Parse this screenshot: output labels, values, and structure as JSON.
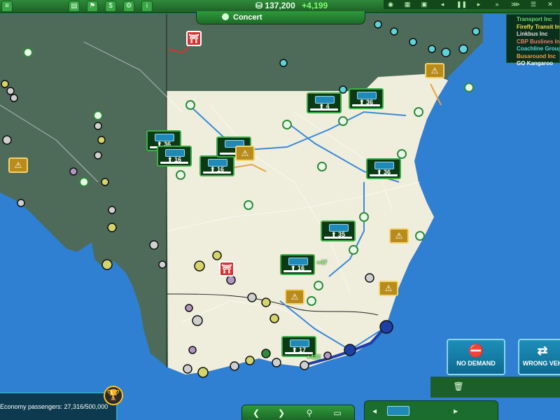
{
  "header": {
    "money": "137,200",
    "money_gain": "+4,199",
    "event_label": "Concert"
  },
  "companies": [
    {
      "name": "Transport Inc",
      "color": "#6cdc6a"
    },
    {
      "name": "Firefly Transit In",
      "color": "#f0e24a"
    },
    {
      "name": "Linkbus Inc",
      "color": "#e0e0e0"
    },
    {
      "name": "CBP Buslines Inc",
      "color": "#e87a6a"
    },
    {
      "name": "Coachline Group",
      "color": "#5cd4d8"
    },
    {
      "name": "Busaround Inc",
      "color": "#e8a33a"
    },
    {
      "name": "GO Kangaroo",
      "color": "#ffffff"
    }
  ],
  "cards": [
    {
      "count": "36"
    },
    {
      "count": "16"
    },
    {
      "count": "16"
    },
    {
      "count": "4"
    },
    {
      "count": "36"
    },
    {
      "count": "36"
    },
    {
      "count": "35"
    },
    {
      "count": "16"
    },
    {
      "count": "17"
    }
  ],
  "gains": [
    "+47",
    "+432"
  ],
  "demand_buttons": [
    {
      "label": "NO DEMAND"
    },
    {
      "label": "WRONG VEH"
    }
  ],
  "footer": {
    "economy_passengers": "Economy passengers: 27,316/500,000"
  },
  "icons": {
    "money": "coin-icon",
    "event": "pin-icon",
    "trophy": "trophy-icon",
    "prev": "arrow-left-icon",
    "next": "arrow-right-icon",
    "location": "location-icon",
    "folder": "folder-icon",
    "trash": "trash-icon",
    "warning": "warning-icon",
    "bus": "bus-icon"
  },
  "colors": {
    "ocean": "#2f7fd3",
    "land_dark": "#4e6a59",
    "land_light": "#efeedd",
    "ui_green": "#2e8a3a",
    "route_blue": "#3b88d6",
    "route_red": "#d83333"
  }
}
